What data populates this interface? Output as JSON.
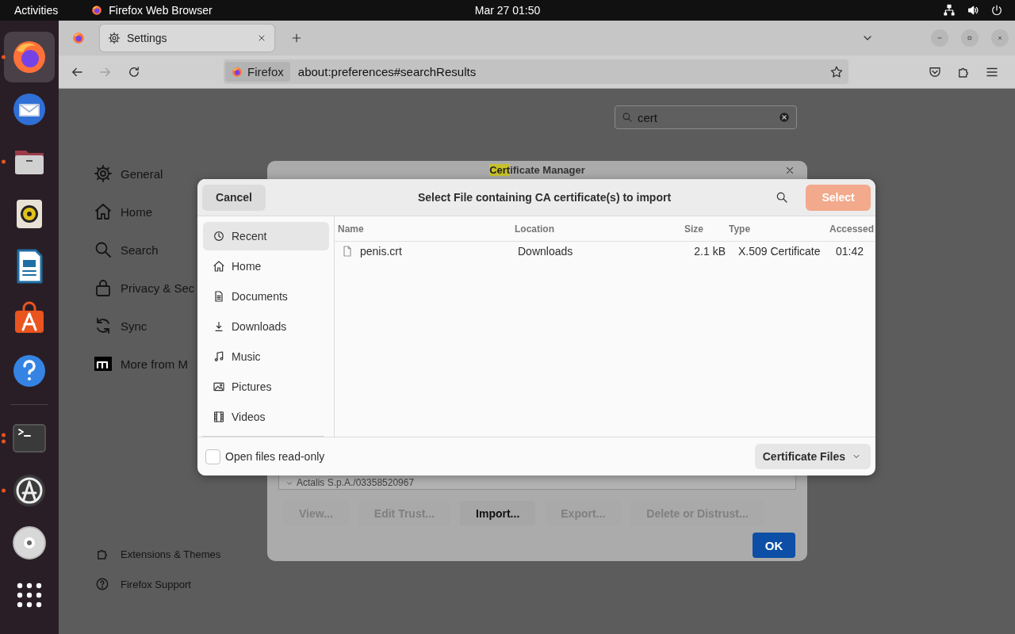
{
  "top_bar": {
    "activities": "Activities",
    "app_name": "Firefox Web Browser",
    "clock": "Mar 27  01:50"
  },
  "dock": {
    "pinned": [
      {
        "kind": "browser",
        "selected": true,
        "running": true
      },
      {
        "kind": "mail",
        "selected": false,
        "running": false
      },
      {
        "kind": "files",
        "selected": false,
        "running": true
      },
      {
        "kind": "music",
        "selected": false,
        "running": false
      },
      {
        "kind": "writer",
        "selected": false,
        "running": false
      },
      {
        "kind": "store",
        "selected": false,
        "running": false
      },
      {
        "kind": "help",
        "selected": false,
        "running": false
      }
    ],
    "others": [
      {
        "kind": "terminal",
        "selected": false,
        "running": true,
        "multiple_windows": true
      },
      {
        "kind": "updater",
        "selected": false,
        "running": true
      },
      {
        "kind": "disc",
        "selected": false,
        "running": false
      }
    ]
  },
  "browser": {
    "tabs": [
      {
        "kind": "pinned",
        "selected": false
      },
      {
        "kind": "page",
        "label": "Settings",
        "selected": true
      }
    ],
    "nav_buttons": [
      {
        "kind": "back",
        "disabled": false
      },
      {
        "kind": "forward",
        "disabled": true
      },
      {
        "kind": "reload",
        "disabled": false
      }
    ],
    "url": {
      "identity": "Firefox",
      "address": "about:preferences#searchResults"
    }
  },
  "settings": {
    "search": {
      "value": "cert"
    },
    "nav": [
      {
        "kind": "gear",
        "label": "General"
      },
      {
        "kind": "house",
        "label": "Home"
      },
      {
        "kind": "magnifier",
        "label": "Search"
      },
      {
        "kind": "lock",
        "label": "Privacy & Sec"
      },
      {
        "kind": "sync",
        "label": "Sync"
      },
      {
        "kind": "mozilla",
        "label": "More from M"
      }
    ],
    "footer_links": [
      {
        "kind": "puzzle",
        "label": "Extensions & Themes"
      },
      {
        "kind": "help",
        "label": "Firefox Support"
      }
    ]
  },
  "certificate_manager": {
    "title": {
      "highlighted": "Cert",
      "rest": "ificate Manager"
    },
    "tree_row": {
      "label": "Actalis S.p.A./03358520967",
      "expanded": true
    },
    "buttons": [
      {
        "label": "View...",
        "disabled": true
      },
      {
        "label": "Edit Trust...",
        "disabled": true
      },
      {
        "label": "Import...",
        "disabled": false
      },
      {
        "label": "Export...",
        "disabled": true
      },
      {
        "label": "Delete or Distrust...",
        "disabled": true
      }
    ],
    "ok": "OK"
  },
  "file_dialog": {
    "title": "Select File containing CA certificate(s) to import",
    "cancel": "Cancel",
    "select": {
      "label": "Select",
      "disabled": true
    },
    "places": [
      {
        "kind": "recent",
        "label": "Recent",
        "selected": true
      },
      {
        "kind": "home",
        "label": "Home",
        "selected": false
      },
      {
        "kind": "documents",
        "label": "Documents",
        "selected": false
      },
      {
        "kind": "downloads",
        "label": "Downloads",
        "selected": false
      },
      {
        "kind": "music",
        "label": "Music",
        "selected": false
      },
      {
        "kind": "pictures",
        "label": "Pictures",
        "selected": false
      },
      {
        "kind": "videos",
        "label": "Videos",
        "selected": false
      }
    ],
    "columns": [
      "Name",
      "Location",
      "Size",
      "Type",
      "Accessed"
    ],
    "rows": [
      {
        "cells": [
          "penis.crt",
          "Downloads",
          "2.1 kB",
          "X.509 Certificate",
          "01:42"
        ],
        "selected": false
      }
    ],
    "read_only": {
      "label": "Open files read-only",
      "checked": false
    },
    "filter": "Certificate Files"
  }
}
